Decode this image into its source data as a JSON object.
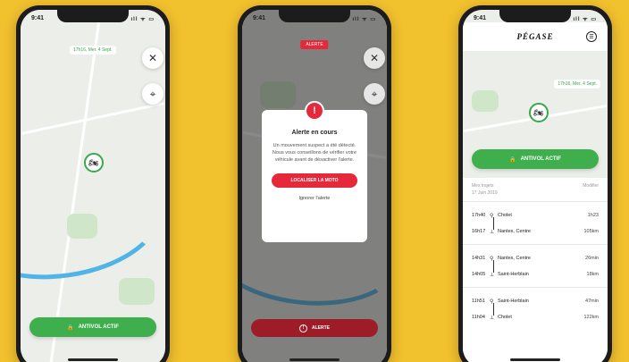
{
  "status_time": "9:41",
  "status_signal": "ıll ᯤ ▭",
  "screen1": {
    "timestamp": "17h16, Mer. 4 Sept.",
    "close_icon": "✕",
    "locate_icon": "⌖",
    "moto_icon": "🏍",
    "lock_icon": "🔒",
    "antivol_label": "ANTIVOL ACTIF"
  },
  "screen2": {
    "alert_tag": "ALERTE",
    "close_icon": "✕",
    "locate_icon": "⌖",
    "modal_icon": "!",
    "modal_title": "Alerte en cours",
    "modal_text": "Un mouvement suspect a été détecté. Nous vous conseillons de vérifier votre véhicule avant de désactiver l'alerte.",
    "modal_cta": "LOCALISER LA MOTO",
    "modal_ignore": "Ignorer l'alerte",
    "bottom_label": "ALERTE",
    "bottom_icon": "!"
  },
  "screen3": {
    "logo": "PÉGASE",
    "menu_icon": "☰",
    "timestamp": "17h16, Mer. 4 Sept.",
    "moto_icon": "🏍",
    "lock_icon": "🔒",
    "antivol_label": "ANTIVOL ACTIF",
    "list_title": "Mes trajets",
    "list_action": "Modifier",
    "list_date": "17 Juin 2019",
    "trips": [
      {
        "start_time": "17h40",
        "start_place": "Cholet",
        "start_meta": "1h23",
        "end_time": "16h17",
        "end_place": "Nantes, Centre",
        "end_meta": "105km"
      },
      {
        "start_time": "14h31",
        "start_place": "Nantes, Centre",
        "start_meta": "26min",
        "end_time": "14h05",
        "end_place": "Saint-Herblain",
        "end_meta": "18km"
      },
      {
        "start_time": "11h51",
        "start_place": "Saint-Herblain",
        "start_meta": "47min",
        "end_time": "11h04",
        "end_place": "Cholet",
        "end_meta": "122km"
      }
    ]
  },
  "colors": {
    "background": "#f2c12e",
    "green": "#3fae4c",
    "red": "#e5283a",
    "river": "#4fb4e6"
  }
}
